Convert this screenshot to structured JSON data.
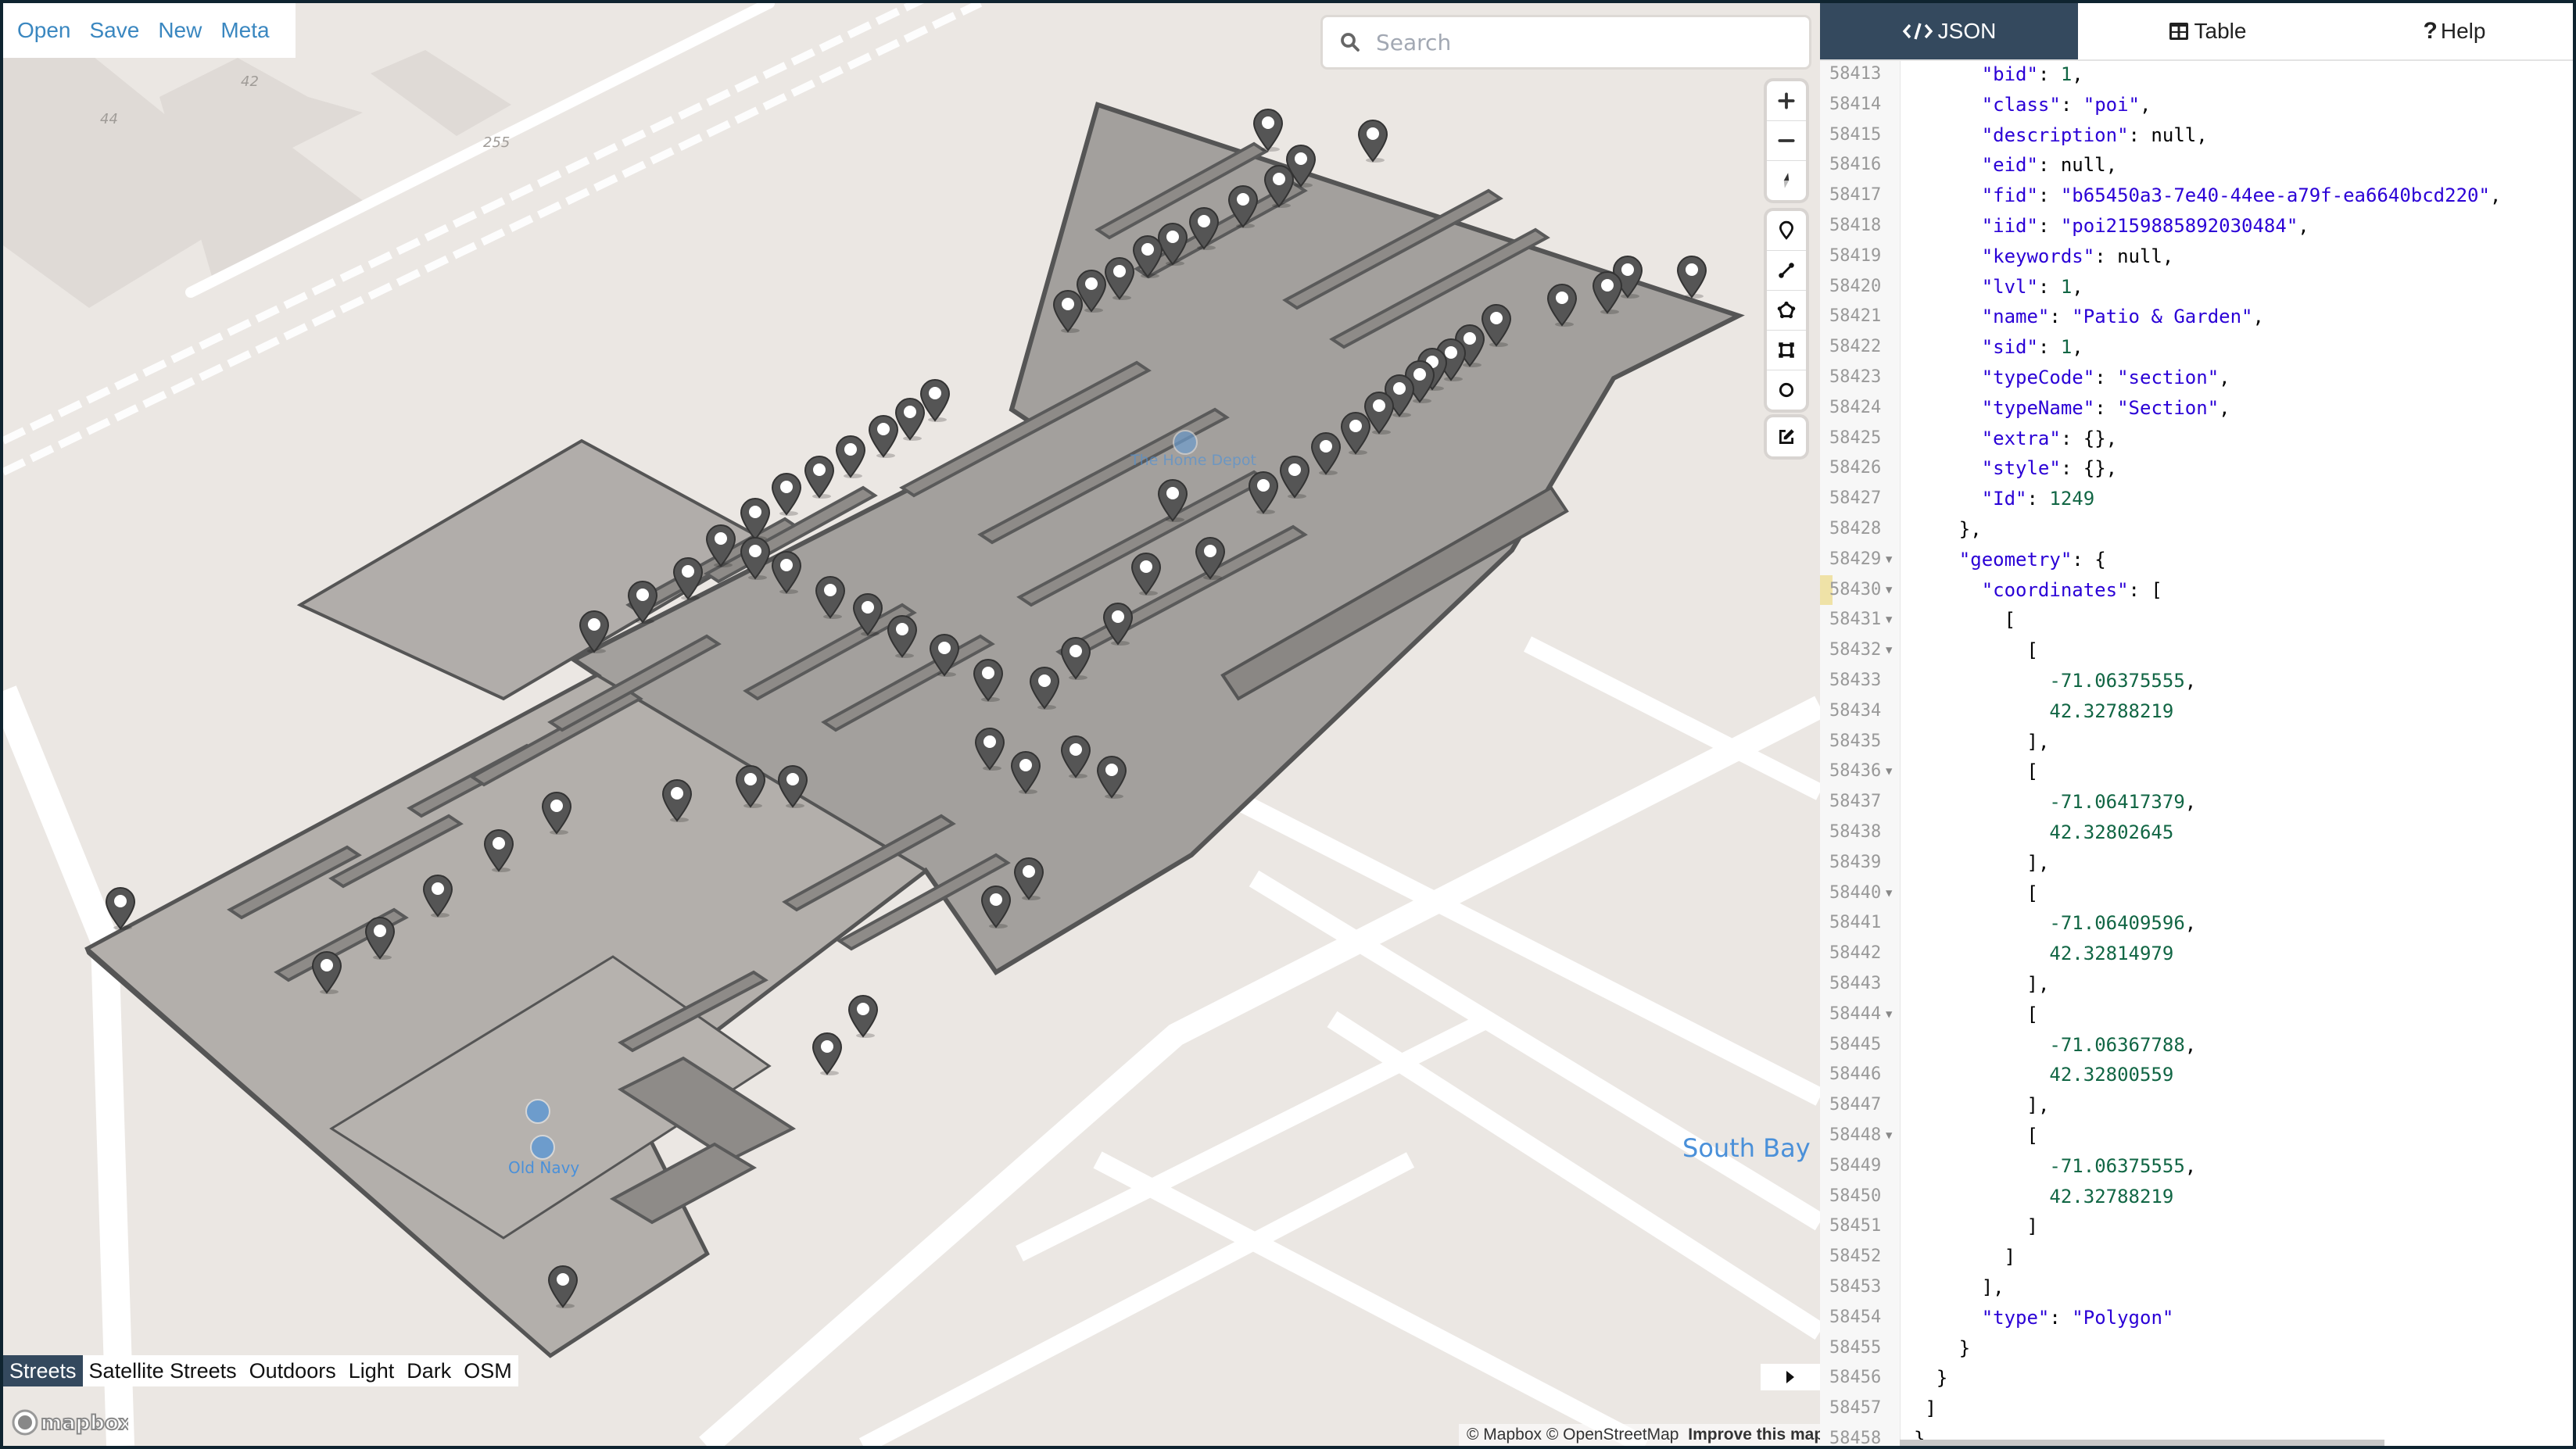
{
  "menu": {
    "items": [
      "Open",
      "Save",
      "New",
      "Meta"
    ]
  },
  "search": {
    "placeholder": "Search",
    "value": ""
  },
  "map_controls": {
    "navigation": [
      "zoom-in",
      "zoom-out",
      "compass"
    ],
    "draw": [
      "draw-point",
      "draw-line",
      "draw-polygon",
      "draw-rectangle",
      "draw-circle"
    ],
    "edit": [
      "edit"
    ]
  },
  "map_labels": {
    "store_main": "The Home Depot",
    "store_secondary": "Old Navy",
    "mall": "South Bay M",
    "building_numbers": [
      "42",
      "44",
      "255"
    ]
  },
  "map_styles": {
    "items": [
      "Streets",
      "Satellite Streets",
      "Outdoors",
      "Light",
      "Dark",
      "OSM"
    ],
    "active": "Streets"
  },
  "attribution": {
    "mapbox": "© Mapbox",
    "osm": "© OpenStreetMap",
    "improve": "Improve this map",
    "logo": "mapbox"
  },
  "panel": {
    "tabs": [
      {
        "label": "JSON",
        "icon": "code-icon",
        "active": true
      },
      {
        "label": "Table",
        "icon": "table-icon",
        "active": false
      },
      {
        "label": "Help",
        "icon": "question-icon",
        "active": false
      }
    ],
    "highlighted_line": 58430,
    "lines": [
      {
        "n": 58413,
        "indent": 6,
        "tokens": [
          [
            "k",
            "\"bid\""
          ],
          [
            "p",
            ": "
          ],
          [
            "n",
            "1"
          ],
          [
            "p",
            ","
          ]
        ]
      },
      {
        "n": 58414,
        "indent": 6,
        "tokens": [
          [
            "k",
            "\"class\""
          ],
          [
            "p",
            ": "
          ],
          [
            "s",
            "\"poi\""
          ],
          [
            "p",
            ","
          ]
        ]
      },
      {
        "n": 58415,
        "indent": 6,
        "tokens": [
          [
            "k",
            "\"description\""
          ],
          [
            "p",
            ": null,"
          ]
        ]
      },
      {
        "n": 58416,
        "indent": 6,
        "tokens": [
          [
            "k",
            "\"eid\""
          ],
          [
            "p",
            ": null,"
          ]
        ]
      },
      {
        "n": 58417,
        "indent": 6,
        "tokens": [
          [
            "k",
            "\"fid\""
          ],
          [
            "p",
            ": "
          ],
          [
            "s",
            "\"b65450a3-7e40-44ee-a79f-ea6640bcd220\""
          ],
          [
            "p",
            ","
          ]
        ]
      },
      {
        "n": 58418,
        "indent": 6,
        "tokens": [
          [
            "k",
            "\"iid\""
          ],
          [
            "p",
            ": "
          ],
          [
            "s",
            "\"poi2159885892030484\""
          ],
          [
            "p",
            ","
          ]
        ]
      },
      {
        "n": 58419,
        "indent": 6,
        "tokens": [
          [
            "k",
            "\"keywords\""
          ],
          [
            "p",
            ": null,"
          ]
        ]
      },
      {
        "n": 58420,
        "indent": 6,
        "tokens": [
          [
            "k",
            "\"lvl\""
          ],
          [
            "p",
            ": "
          ],
          [
            "n",
            "1"
          ],
          [
            "p",
            ","
          ]
        ]
      },
      {
        "n": 58421,
        "indent": 6,
        "tokens": [
          [
            "k",
            "\"name\""
          ],
          [
            "p",
            ": "
          ],
          [
            "s",
            "\"Patio & Garden\""
          ],
          [
            "p",
            ","
          ]
        ]
      },
      {
        "n": 58422,
        "indent": 6,
        "tokens": [
          [
            "k",
            "\"sid\""
          ],
          [
            "p",
            ": "
          ],
          [
            "n",
            "1"
          ],
          [
            "p",
            ","
          ]
        ]
      },
      {
        "n": 58423,
        "indent": 6,
        "tokens": [
          [
            "k",
            "\"typeCode\""
          ],
          [
            "p",
            ": "
          ],
          [
            "s",
            "\"section\""
          ],
          [
            "p",
            ","
          ]
        ]
      },
      {
        "n": 58424,
        "indent": 6,
        "tokens": [
          [
            "k",
            "\"typeName\""
          ],
          [
            "p",
            ": "
          ],
          [
            "s",
            "\"Section\""
          ],
          [
            "p",
            ","
          ]
        ]
      },
      {
        "n": 58425,
        "indent": 6,
        "tokens": [
          [
            "k",
            "\"extra\""
          ],
          [
            "p",
            ": {},"
          ]
        ]
      },
      {
        "n": 58426,
        "indent": 6,
        "tokens": [
          [
            "k",
            "\"style\""
          ],
          [
            "p",
            ": {},"
          ]
        ]
      },
      {
        "n": 58427,
        "indent": 6,
        "tokens": [
          [
            "k",
            "\"Id\""
          ],
          [
            "p",
            ": "
          ],
          [
            "n",
            "1249"
          ]
        ]
      },
      {
        "n": 58428,
        "indent": 4,
        "tokens": [
          [
            "p",
            "},"
          ]
        ]
      },
      {
        "n": 58429,
        "indent": 4,
        "fold": true,
        "tokens": [
          [
            "k",
            "\"geometry\""
          ],
          [
            "p",
            ": {"
          ]
        ]
      },
      {
        "n": 58430,
        "indent": 6,
        "fold": true,
        "tokens": [
          [
            "k",
            "\"coordinates\""
          ],
          [
            "p",
            ": ["
          ]
        ]
      },
      {
        "n": 58431,
        "indent": 8,
        "fold": true,
        "tokens": [
          [
            "p",
            "["
          ]
        ]
      },
      {
        "n": 58432,
        "indent": 10,
        "fold": true,
        "tokens": [
          [
            "p",
            "["
          ]
        ]
      },
      {
        "n": 58433,
        "indent": 12,
        "tokens": [
          [
            "n",
            "-71.06375555"
          ],
          [
            "p",
            ","
          ]
        ]
      },
      {
        "n": 58434,
        "indent": 12,
        "tokens": [
          [
            "n",
            "42.32788219"
          ]
        ]
      },
      {
        "n": 58435,
        "indent": 10,
        "tokens": [
          [
            "p",
            "],"
          ]
        ]
      },
      {
        "n": 58436,
        "indent": 10,
        "fold": true,
        "tokens": [
          [
            "p",
            "["
          ]
        ]
      },
      {
        "n": 58437,
        "indent": 12,
        "tokens": [
          [
            "n",
            "-71.06417379"
          ],
          [
            "p",
            ","
          ]
        ]
      },
      {
        "n": 58438,
        "indent": 12,
        "tokens": [
          [
            "n",
            "42.32802645"
          ]
        ]
      },
      {
        "n": 58439,
        "indent": 10,
        "tokens": [
          [
            "p",
            "],"
          ]
        ]
      },
      {
        "n": 58440,
        "indent": 10,
        "fold": true,
        "tokens": [
          [
            "p",
            "["
          ]
        ]
      },
      {
        "n": 58441,
        "indent": 12,
        "tokens": [
          [
            "n",
            "-71.06409596"
          ],
          [
            "p",
            ","
          ]
        ]
      },
      {
        "n": 58442,
        "indent": 12,
        "tokens": [
          [
            "n",
            "42.32814979"
          ]
        ]
      },
      {
        "n": 58443,
        "indent": 10,
        "tokens": [
          [
            "p",
            "],"
          ]
        ]
      },
      {
        "n": 58444,
        "indent": 10,
        "fold": true,
        "tokens": [
          [
            "p",
            "["
          ]
        ]
      },
      {
        "n": 58445,
        "indent": 12,
        "tokens": [
          [
            "n",
            "-71.06367788"
          ],
          [
            "p",
            ","
          ]
        ]
      },
      {
        "n": 58446,
        "indent": 12,
        "tokens": [
          [
            "n",
            "42.32800559"
          ]
        ]
      },
      {
        "n": 58447,
        "indent": 10,
        "tokens": [
          [
            "p",
            "],"
          ]
        ]
      },
      {
        "n": 58448,
        "indent": 10,
        "fold": true,
        "tokens": [
          [
            "p",
            "["
          ]
        ]
      },
      {
        "n": 58449,
        "indent": 12,
        "tokens": [
          [
            "n",
            "-71.06375555"
          ],
          [
            "p",
            ","
          ]
        ]
      },
      {
        "n": 58450,
        "indent": 12,
        "tokens": [
          [
            "n",
            "42.32788219"
          ]
        ]
      },
      {
        "n": 58451,
        "indent": 10,
        "tokens": [
          [
            "p",
            "]"
          ]
        ]
      },
      {
        "n": 58452,
        "indent": 8,
        "tokens": [
          [
            "p",
            "]"
          ]
        ]
      },
      {
        "n": 58453,
        "indent": 6,
        "tokens": [
          [
            "p",
            "],"
          ]
        ]
      },
      {
        "n": 58454,
        "indent": 6,
        "tokens": [
          [
            "k",
            "\"type\""
          ],
          [
            "p",
            ": "
          ],
          [
            "s",
            "\"Polygon\""
          ]
        ]
      },
      {
        "n": 58455,
        "indent": 4,
        "tokens": [
          [
            "p",
            "}"
          ]
        ]
      },
      {
        "n": 58456,
        "indent": 2,
        "tokens": [
          [
            "p",
            "}"
          ]
        ]
      },
      {
        "n": 58457,
        "indent": 1,
        "tokens": [
          [
            "p",
            "]"
          ]
        ]
      },
      {
        "n": 58458,
        "indent": 0,
        "tokens": [
          [
            "p",
            "}"
          ]
        ]
      }
    ]
  },
  "colors": {
    "accent": "#3a87c0",
    "tab_active": "#34495e",
    "pin": "#555555",
    "json_key": "#2a00d6",
    "json_number": "#116644",
    "map_label": "#4a90d9"
  }
}
